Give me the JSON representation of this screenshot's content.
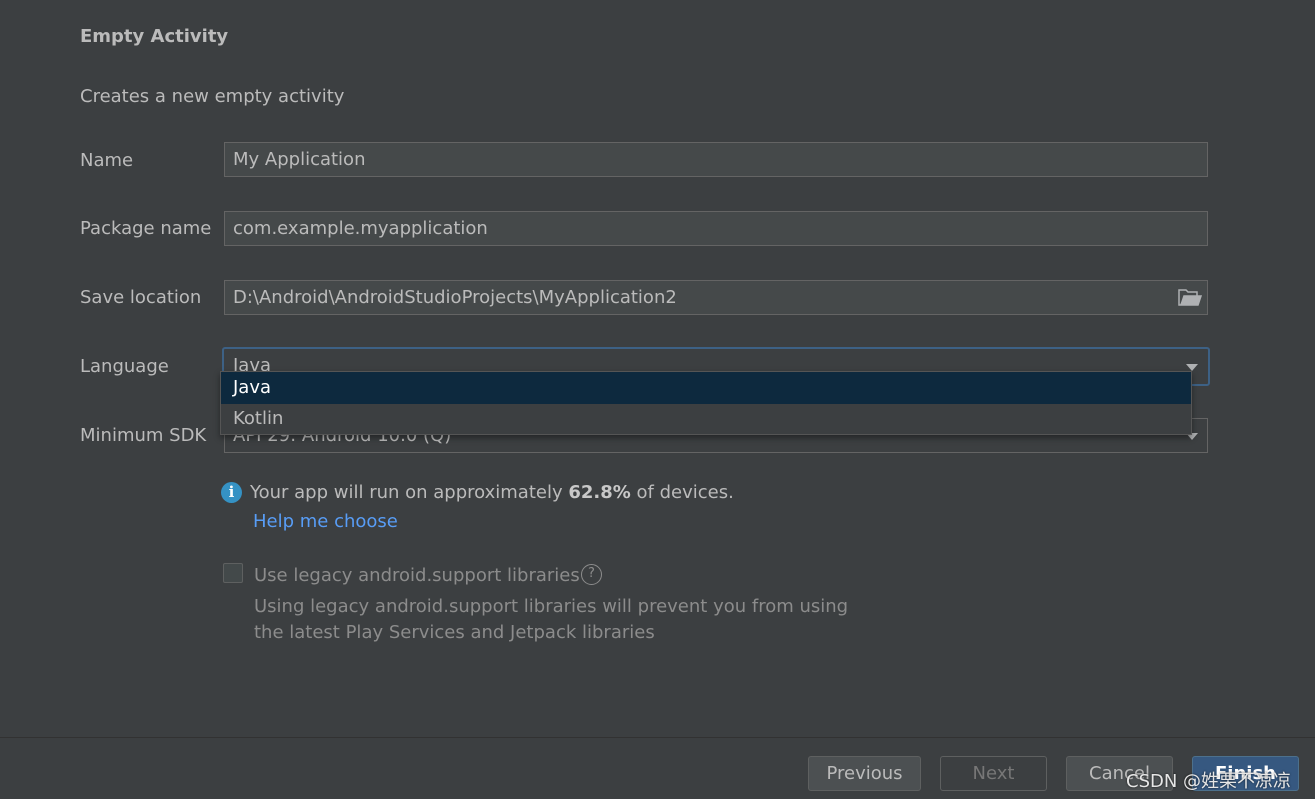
{
  "header": {
    "title": "Empty Activity",
    "description": "Creates a new empty activity"
  },
  "form": {
    "name": {
      "label": "Name",
      "value": "My Application"
    },
    "package": {
      "label": "Package name",
      "value": "com.example.myapplication"
    },
    "save_location": {
      "label": "Save location",
      "value": "D:\\Android\\AndroidStudioProjects\\MyApplication2",
      "icon": "folder-icon"
    },
    "language": {
      "label": "Language",
      "value": "Java",
      "options": [
        "Java",
        "Kotlin"
      ],
      "selected_index": 0
    },
    "min_sdk": {
      "label": "Minimum SDK",
      "value": "API 29: Android 10.0 (Q)"
    }
  },
  "info": {
    "icon": "info-icon",
    "text_before": "Your app will run on approximately ",
    "percent": "62.8%",
    "text_after": " of devices.",
    "help_link": "Help me choose"
  },
  "legacy": {
    "checked": false,
    "label": "Use legacy android.support libraries",
    "help_icon": "question-icon",
    "note_line1": "Using legacy android.support libraries will prevent you from using",
    "note_line2": "the latest Play Services and Jetpack libraries"
  },
  "buttons": {
    "previous": "Previous",
    "next": "Next",
    "cancel": "Cancel",
    "finish": "Finish"
  },
  "watermark": "CSDN @姓栗不凉凉",
  "colors": {
    "background": "#3c3f41",
    "field_bg": "#45494a",
    "focus_border": "#3d6185",
    "selection": "#0d293e",
    "link": "#589df6",
    "info": "#3592c4",
    "primary_button": "#365880"
  }
}
